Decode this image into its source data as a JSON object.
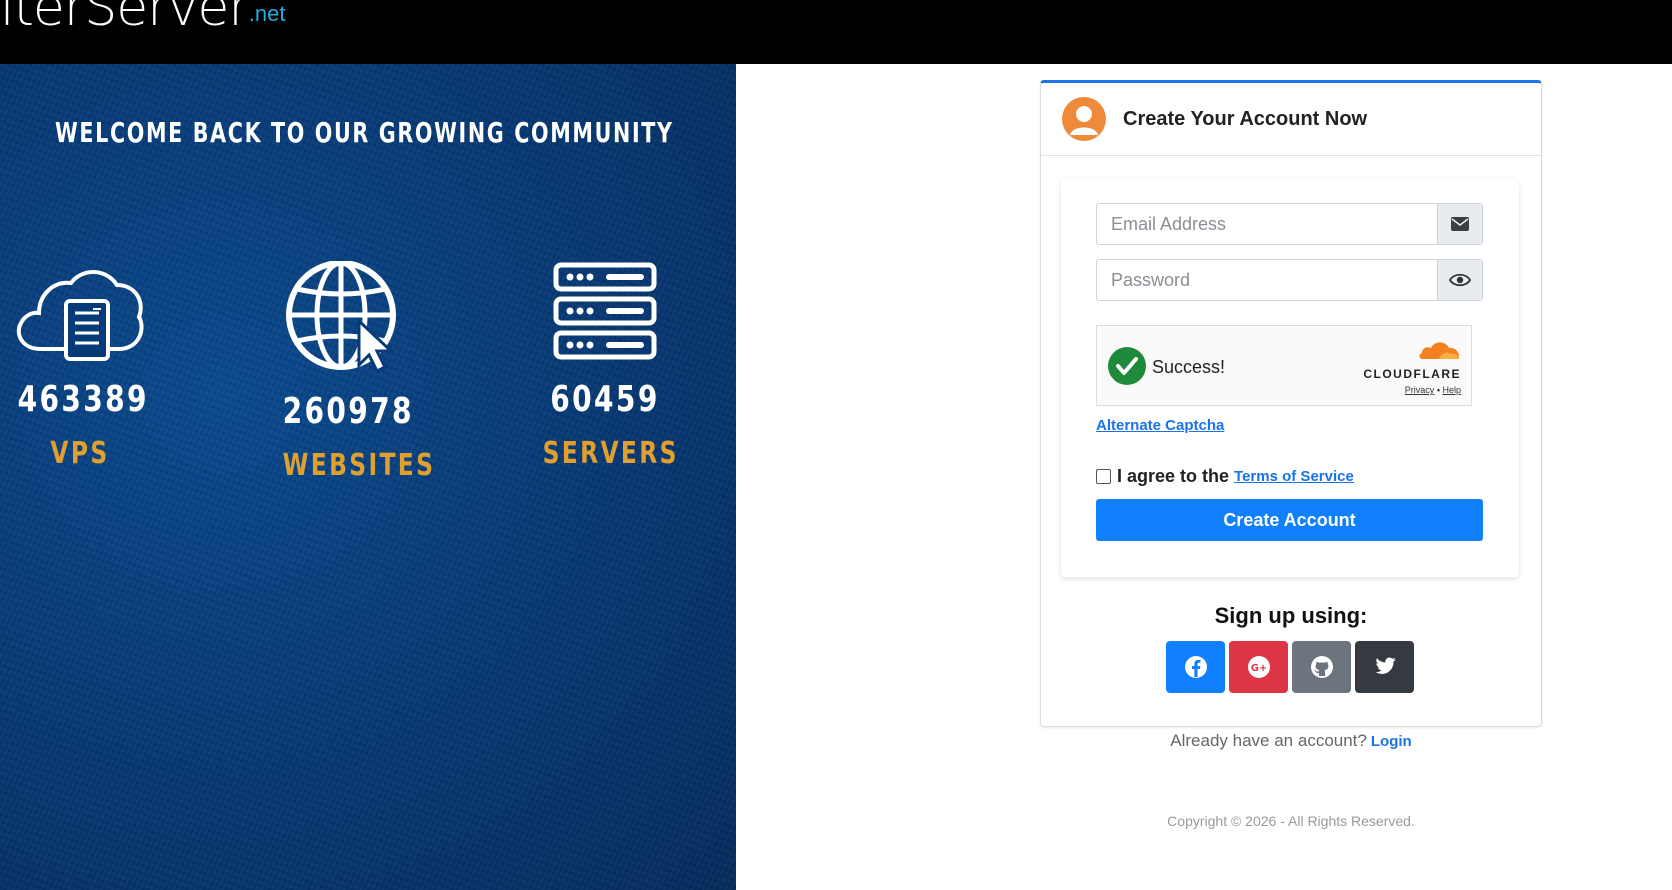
{
  "header": {
    "logo_main": "iterServer",
    "logo_suffix": ".net"
  },
  "hero": {
    "heading": "WELCOME BACK TO OUR GROWING COMMUNITY",
    "stats": [
      {
        "icon": "cloud-server-icon",
        "value": "463389",
        "label": "VPS"
      },
      {
        "icon": "globe-cursor-icon",
        "value": "260978",
        "label": "WEBSITES"
      },
      {
        "icon": "server-rack-icon",
        "value": "60459",
        "label": "SERVERS"
      }
    ],
    "colors": {
      "background": "#073b78",
      "label": "#e0a030"
    }
  },
  "form": {
    "title": "Create Your Account Now",
    "email_placeholder": "Email Address",
    "password_placeholder": "Password",
    "captcha": {
      "status": "Success!",
      "brand": "CLOUDFLARE",
      "privacy": "Privacy",
      "separator": "•",
      "help": "Help"
    },
    "alternate_captcha": "Alternate Captcha",
    "agree_text": "I agree to the",
    "terms_link": "Terms of Service",
    "submit_label": "Create Account",
    "accent_color": "#1080ff"
  },
  "social": {
    "heading": "Sign up using:",
    "buttons": [
      {
        "name": "facebook",
        "icon": "facebook-icon",
        "color": "#1080ff"
      },
      {
        "name": "google",
        "icon": "google-plus-icon",
        "color": "#dc3545"
      },
      {
        "name": "github",
        "icon": "github-icon",
        "color": "#6c757d"
      },
      {
        "name": "twitter",
        "icon": "twitter-icon",
        "color": "#343a40"
      }
    ]
  },
  "footer": {
    "already_text": "Already have an account?",
    "login_link": "Login",
    "copyright": "Copyright © 2026 - All Rights Reserved."
  }
}
